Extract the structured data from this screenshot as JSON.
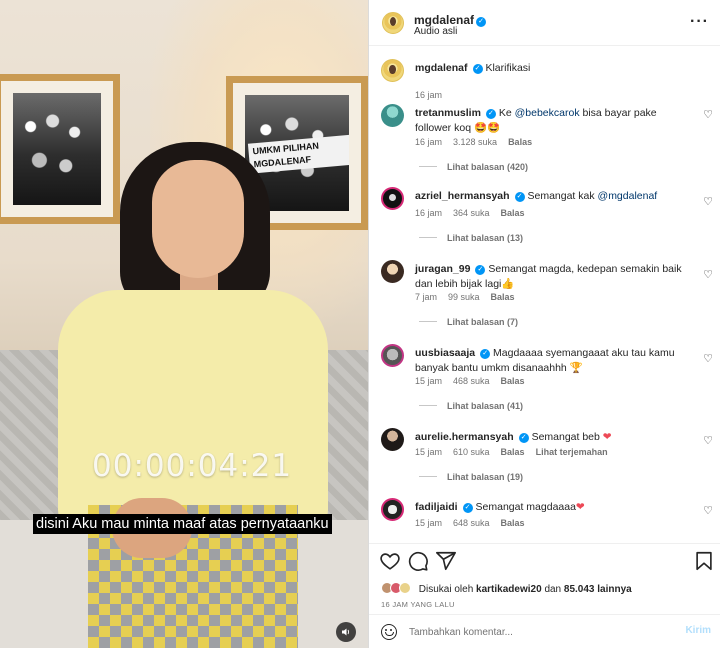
{
  "video": {
    "timecode": "00:00:04:21",
    "subtitle": "disini Aku mau minta maaf atas pernyataanku",
    "banner_text": "UMKM PILIHAN MGDALENAF",
    "mute_icon": "speaker-icon"
  },
  "header": {
    "username": "mgdalenaf",
    "audio_label": "Audio asli",
    "more_icon": "more-icon"
  },
  "comments": [
    {
      "username": "mgdalenaf",
      "text": "Klarifikasi",
      "time": "16 jam",
      "is_caption": true
    },
    {
      "username": "tretanmuslim",
      "mention": "@bebekcarok",
      "pre": "Ke ",
      "text": " bisa bayar pake follower koq ",
      "emoji": "🤩🤩",
      "time": "16 jam",
      "likes": "3.128 suka",
      "reply": "Balas",
      "replies": "Lihat balasan (420)"
    },
    {
      "username": "azriel_hermansyah",
      "pre": "Semangat kak ",
      "mention": "@mgdalenaf",
      "time": "16 jam",
      "likes": "364 suka",
      "reply": "Balas",
      "replies": "Lihat balasan (13)"
    },
    {
      "username": "juragan_99",
      "text": "Semangat magda, kedepan semakin baik dan lebih bijak lagi",
      "emoji": "👍",
      "time": "7 jam",
      "likes": "99 suka",
      "reply": "Balas",
      "replies": "Lihat balasan (7)"
    },
    {
      "username": "uusbiasaaja",
      "text": "Magdaaaa syemangaaat aku tau kamu banyak bantu umkm disanaahhh ",
      "emoji": "🏆",
      "time": "15 jam",
      "likes": "468 suka",
      "reply": "Balas",
      "replies": "Lihat balasan (41)"
    },
    {
      "username": "aurelie.hermansyah",
      "text": "Semangat beb ",
      "emoji": "❤",
      "time": "15 jam",
      "likes": "610 suka",
      "reply": "Balas",
      "translate": "Lihat terjemahan",
      "replies": "Lihat balasan (19)"
    },
    {
      "username": "fadiljaidi",
      "text": "Semangat magdaaaa",
      "emoji": "❤",
      "time": "15 jam",
      "likes": "648 suka",
      "reply": "Balas"
    }
  ],
  "actions": {
    "liked_by_prefix": "Disukai oleh",
    "liked_by_user": "kartikadewi20",
    "liked_by_mid": "dan",
    "liked_by_count": "85.043 lainnya",
    "post_time": "16 JAM YANG LALU",
    "comment_placeholder": "Tambahkan komentar...",
    "post_label": "Kirim"
  },
  "colors": {
    "verified": "#0095f6",
    "post_disabled": "#b2dffc",
    "heart_red": "#ed4956",
    "link": "#00376b"
  }
}
